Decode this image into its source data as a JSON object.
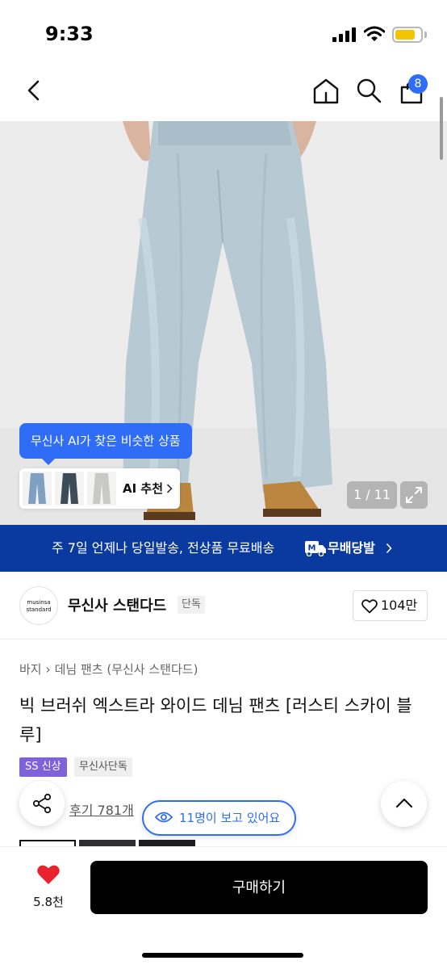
{
  "status_bar": {
    "time": "9:33"
  },
  "nav": {
    "cart_count": "8",
    "icons": [
      "back-icon",
      "home-icon",
      "search-icon",
      "cart-icon"
    ]
  },
  "gallery": {
    "ai_tooltip": "무신사 AI가 찾은 비슷한 상품",
    "ai_label": "AI 추천",
    "pager": "1 / 11"
  },
  "banner": {
    "text": "주 7일 언제나 당일발송, 전상품 무료배송",
    "brand": "무배당발",
    "logo_letter": "M",
    "color": "#0a3aa0"
  },
  "brand": {
    "logo_line1": "musinsa",
    "logo_line2": "standard",
    "name": "무신사 스탠다드",
    "tag": "단독",
    "likes": "104만"
  },
  "product": {
    "breadcrumb": [
      "바지",
      "데님 팬츠 (무신사 스탠다드)"
    ],
    "title": "빅 브러쉬 엑스트라 와이드 데님 팬츠 [러스티 스카이 블루]",
    "tags": [
      "SS 신상",
      "무신사단독"
    ],
    "reviews": "후기 781개",
    "viewers": "11명이 보고 있어요"
  },
  "bottom": {
    "wish_count": "5.8천",
    "buy_label": "구매하기"
  },
  "colors": {
    "accent": "#2f6df6",
    "heart": "#e8232e",
    "new_tag": "#7f61d9"
  }
}
